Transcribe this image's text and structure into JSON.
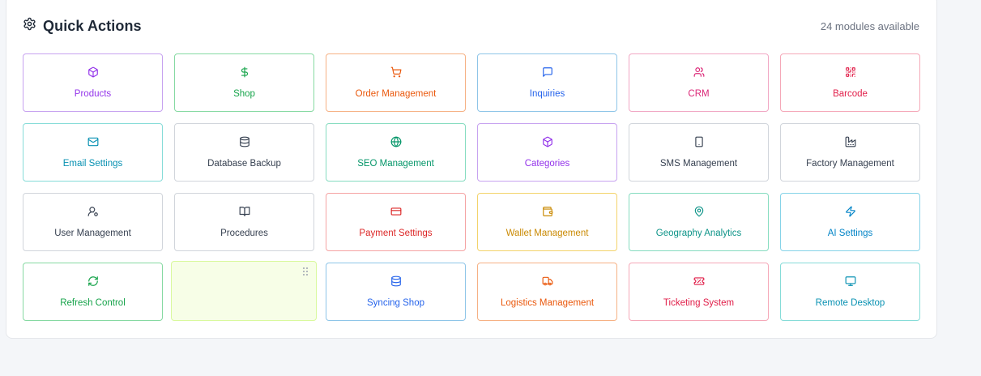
{
  "header": {
    "title": "Quick Actions",
    "icon": "gear-icon",
    "count_label": "24 modules available"
  },
  "tiles": [
    {
      "label": "Products",
      "icon": "box-icon",
      "color": "#9333ea",
      "border": "#c7a2f0"
    },
    {
      "label": "Shop",
      "icon": "dollar-icon",
      "color": "#16a34a",
      "border": "#86d9a2"
    },
    {
      "label": "Order Management",
      "icon": "cart-icon",
      "color": "#ea580c",
      "border": "#f6b184"
    },
    {
      "label": "Inquiries",
      "icon": "message-icon",
      "color": "#2563eb",
      "border": "#8ec5e8"
    },
    {
      "label": "CRM",
      "icon": "users-icon",
      "color": "#db2777",
      "border": "#f1a7c4"
    },
    {
      "label": "Barcode",
      "icon": "qr-icon",
      "color": "#e11d48",
      "border": "#f5a8b8"
    },
    {
      "label": "Email Settings",
      "icon": "mail-icon",
      "color": "#0891b2",
      "border": "#86dcd8"
    },
    {
      "label": "Database Backup",
      "icon": "database-icon",
      "color": "#374151",
      "border": "#d1d5db"
    },
    {
      "label": "SEO Management",
      "icon": "globe-icon",
      "color": "#059669",
      "border": "#86dcc0"
    },
    {
      "label": "Categories",
      "icon": "box-icon",
      "color": "#9333ea",
      "border": "#c7a2f0"
    },
    {
      "label": "SMS Management",
      "icon": "phone-icon",
      "color": "#374151",
      "border": "#d1d5db"
    },
    {
      "label": "Factory Management",
      "icon": "factory-icon",
      "color": "#374151",
      "border": "#d1d5db"
    },
    {
      "label": "User Management",
      "icon": "user-gear-icon",
      "color": "#374151",
      "border": "#d1d5db"
    },
    {
      "label": "Procedures",
      "icon": "book-icon",
      "color": "#374151",
      "border": "#d1d5db"
    },
    {
      "label": "Payment Settings",
      "icon": "card-icon",
      "color": "#dc2626",
      "border": "#f5a3a3"
    },
    {
      "label": "Wallet Management",
      "icon": "wallet-icon",
      "color": "#ca8a04",
      "border": "#f3d36b"
    },
    {
      "label": "Geography Analytics",
      "icon": "pin-icon",
      "color": "#0d9488",
      "border": "#86dcc0"
    },
    {
      "label": "AI Settings",
      "icon": "bolt-icon",
      "color": "#0284c7",
      "border": "#86d3e8"
    },
    {
      "label": "Refresh Control",
      "icon": "refresh-icon",
      "color": "#16a34a",
      "border": "#86d9a2"
    },
    {
      "label": "",
      "icon": "",
      "color": "#84cc16",
      "border": "#d9f99d",
      "dragging": true
    },
    {
      "label": "Syncing Shop",
      "icon": "database-icon",
      "color": "#2563eb",
      "border": "#8ec5e8"
    },
    {
      "label": "Logistics Management",
      "icon": "truck-icon",
      "color": "#ea580c",
      "border": "#f6b184"
    },
    {
      "label": "Ticketing System",
      "icon": "ticket-icon",
      "color": "#e11d48",
      "border": "#f5a8b8"
    },
    {
      "label": "Remote Desktop",
      "icon": "monitor-icon",
      "color": "#0891b2",
      "border": "#86dcd8"
    }
  ]
}
